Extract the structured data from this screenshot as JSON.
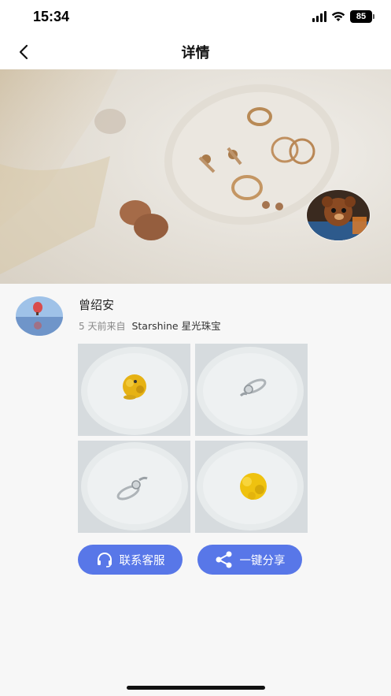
{
  "status_bar": {
    "time": "15:34",
    "battery": "85"
  },
  "nav": {
    "title": "详情"
  },
  "post": {
    "user_name": "曾绍安",
    "time_ago": "5 天前来自",
    "shop_name": "Starshine 星光珠宝",
    "photos": [
      "gold-flower-ring",
      "silver-ring",
      "silver-ring",
      "gold-flower-ring"
    ]
  },
  "actions": {
    "contact_label": "联系客服",
    "share_label": "一键分享"
  },
  "colors": {
    "accent": "#5877e8",
    "background": "#f7f7f7"
  }
}
